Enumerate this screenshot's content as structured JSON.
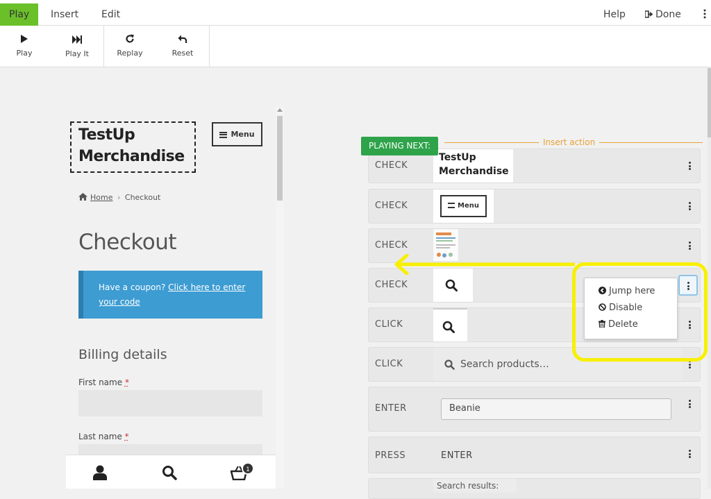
{
  "menubar": {
    "tabs": [
      "Play",
      "Insert",
      "Edit"
    ],
    "help": "Help",
    "done": "Done"
  },
  "toolbar": {
    "play": "Play",
    "play_it": "Play It",
    "replay": "Replay",
    "reset": "Reset"
  },
  "preview": {
    "brand_line1": "TestUp",
    "brand_line2": "Merchandise",
    "menu_button": "Menu",
    "breadcrumb_home": "Home",
    "breadcrumb_sep": "›",
    "breadcrumb_current": "Checkout",
    "page_title": "Checkout",
    "coupon_text": "Have a coupon?",
    "coupon_link": "Click here to enter your code",
    "billing_title": "Billing details",
    "first_name_label": "First name",
    "last_name_label": "Last name",
    "required_mark": "*",
    "cart_count": "1"
  },
  "actions": {
    "playing_next": "PLAYING NEXT:",
    "insert_action": "Insert action",
    "rows": [
      {
        "verb": "CHECK",
        "target_line1": "TestUp",
        "target_line2": "Merchandise"
      },
      {
        "verb": "CHECK",
        "target": "Menu"
      },
      {
        "verb": "CHECK",
        "target": "image-thumbnail"
      },
      {
        "verb": "CHECK",
        "target": "search-icon"
      },
      {
        "verb": "CLICK",
        "target": "search-icon"
      },
      {
        "verb": "CLICK",
        "target": "Search products…"
      },
      {
        "verb": "ENTER",
        "value": "Beanie"
      },
      {
        "verb": "PRESS",
        "value": "ENTER"
      },
      {
        "verb": "",
        "target": "Search results:"
      }
    ]
  },
  "context_menu": {
    "items": [
      "Jump here",
      "Disable",
      "Delete"
    ]
  },
  "colors": {
    "active_tab": "#6bc02a",
    "playing_next": "#2ea34a",
    "insert_action": "#e8a134",
    "coupon": "#3d9cd2",
    "highlight": "#f8f000"
  }
}
